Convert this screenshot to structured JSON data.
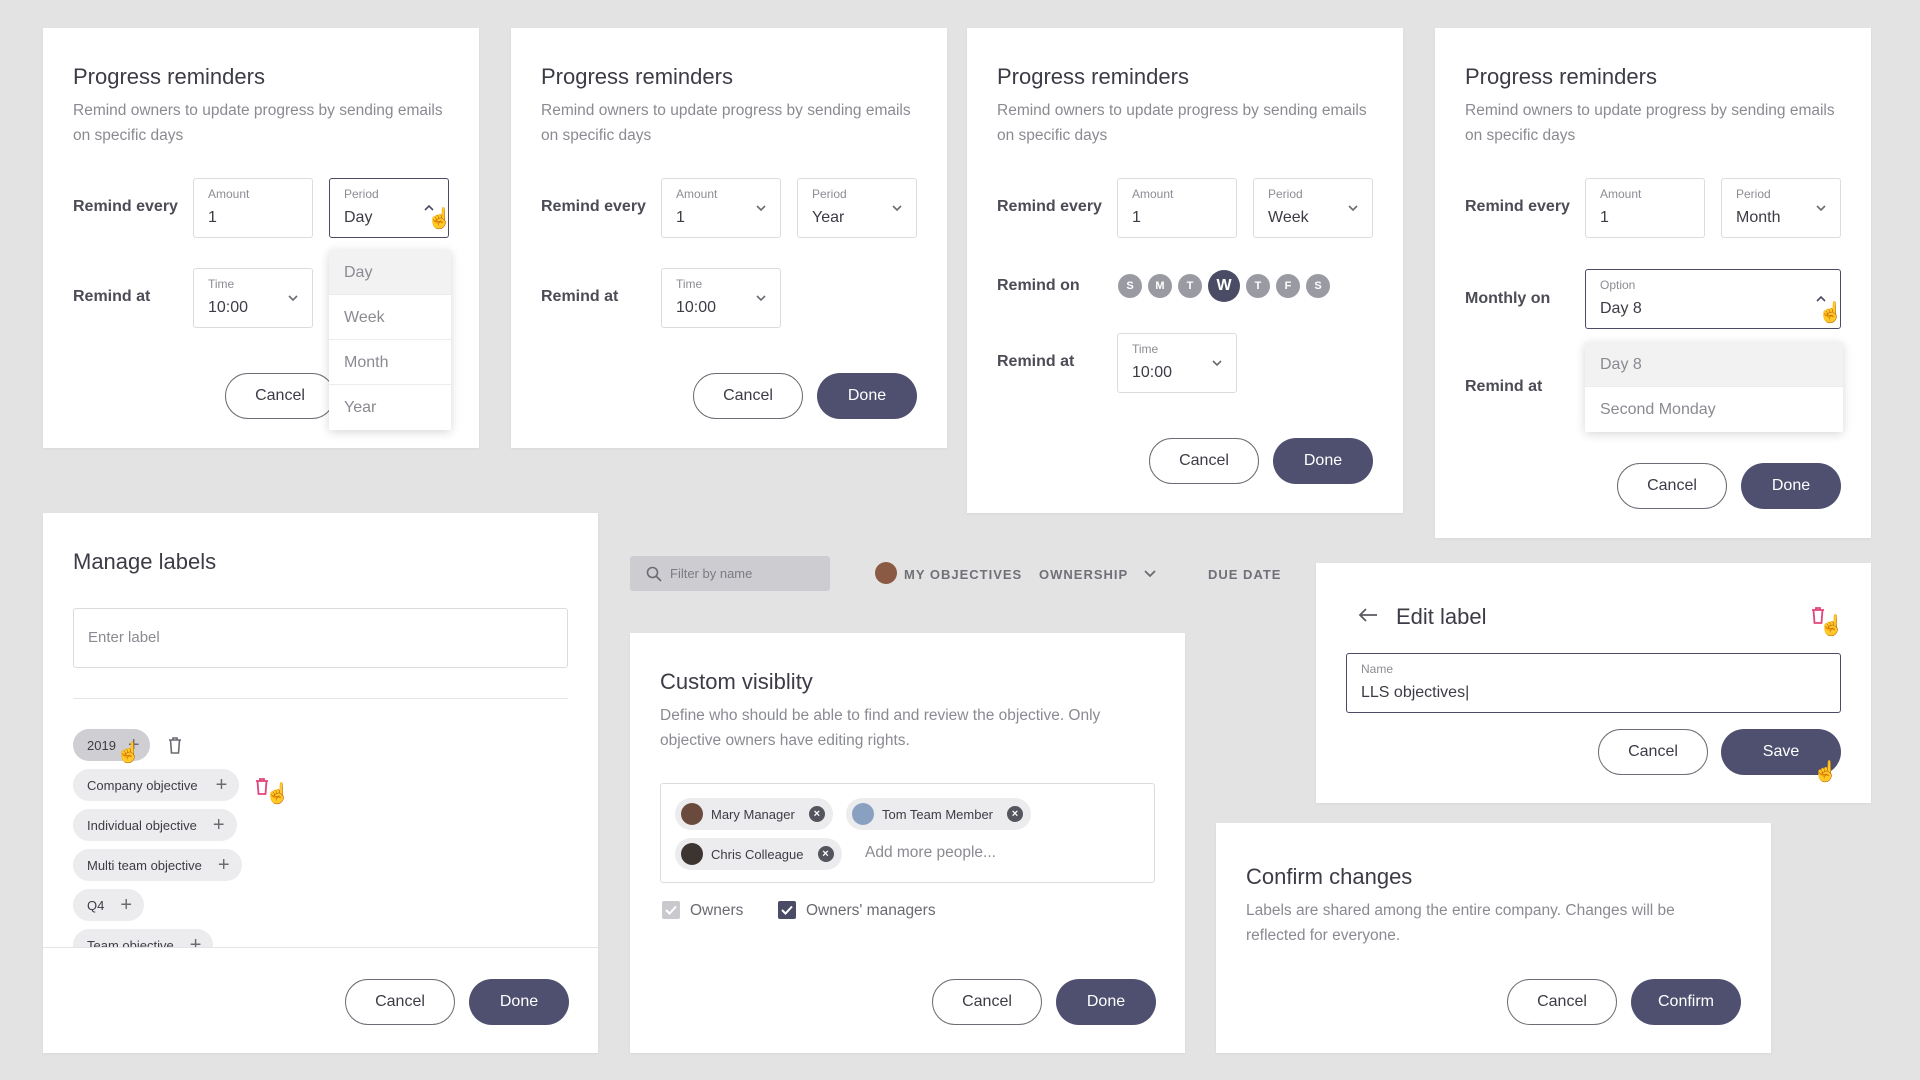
{
  "common": {
    "pr_title": "Progress reminders",
    "pr_desc": "Remind owners to update progress by sending emails on specific days",
    "remind_every": "Remind every",
    "remind_at": "Remind at",
    "remind_on": "Remind on",
    "monthly_on": "Monthly on",
    "amount_label": "Amount",
    "period_label": "Period",
    "time_label": "Time",
    "option_label": "Option",
    "amount_value": "1",
    "time_value": "10:00",
    "cancel": "Cancel",
    "done": "Done"
  },
  "card1": {
    "period_value": "Day",
    "menu": [
      "Day",
      "Week",
      "Month",
      "Year"
    ]
  },
  "card2": {
    "period_value": "Year"
  },
  "card3": {
    "period_value": "Week",
    "days": [
      "S",
      "M",
      "T",
      "W",
      "T",
      "F",
      "S"
    ]
  },
  "card4": {
    "period_value": "Month",
    "option_value": "Day 8",
    "menu": [
      "Day 8",
      "Second Monday"
    ]
  },
  "labels": {
    "title": "Manage labels",
    "placeholder": "Enter label",
    "chips": [
      "2019",
      "Company objective",
      "Individual objective",
      "Multi team objective",
      "Q4",
      "Team objective"
    ]
  },
  "filters": {
    "search_placeholder": "Filter by name",
    "my_objectives": "MY OBJECTIVES",
    "ownership": "OWNERSHIP",
    "due_date": "DUE DATE"
  },
  "visibility": {
    "title": "Custom visiblity",
    "desc": "Define who should be able to find and review the objective. Only objective owners have editing rights.",
    "people": [
      "Mary Manager",
      "Tom Team Member",
      "Chris Colleague"
    ],
    "add_more": "Add more people...",
    "owners": "Owners",
    "owners_managers": "Owners' managers"
  },
  "edit_label": {
    "title": "Edit label",
    "name_label": "Name",
    "name_value": "LLS objectives|",
    "cancel": "Cancel",
    "save": "Save"
  },
  "confirm": {
    "title": "Confirm changes",
    "desc": "Labels are shared among the entire company. Changes will be reflected for everyone.",
    "cancel": "Cancel",
    "confirm": "Confirm"
  },
  "colors": {
    "primary": "#4f5070",
    "danger": "#e0457b"
  }
}
